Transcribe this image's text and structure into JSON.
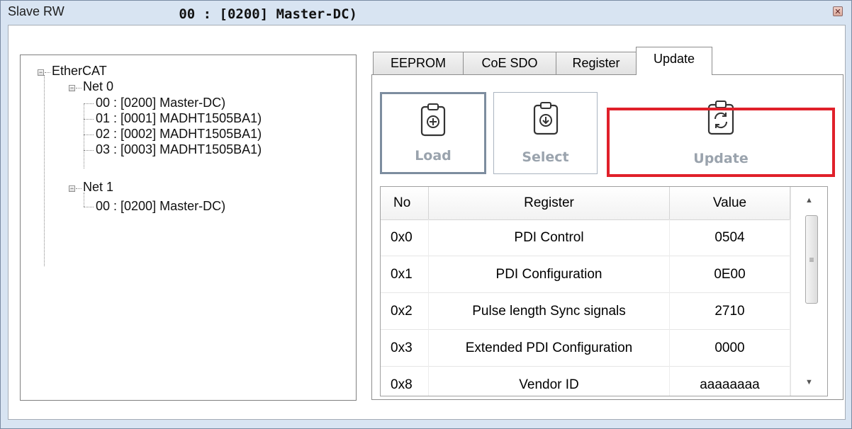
{
  "window": {
    "title": "Slave RW",
    "close_glyph": "✕"
  },
  "slave_header": "00 : [0200] Master-DC)",
  "tree": {
    "root": "EtherCAT",
    "net0": {
      "label": "Net 0",
      "children": [
        "00 : [0200] Master-DC)",
        "01 : [0001] MADHT1505BA1)",
        "02 : [0002] MADHT1505BA1)",
        "03 : [0003] MADHT1505BA1)"
      ]
    },
    "net1": {
      "label": "Net 1",
      "children": [
        "00 : [0200] Master-DC)"
      ]
    }
  },
  "tabs": [
    {
      "label": "EEPROM",
      "active": false
    },
    {
      "label": "CoE SDO",
      "active": false
    },
    {
      "label": "Register",
      "active": false
    },
    {
      "label": "Update",
      "active": true
    }
  ],
  "toolbar": {
    "load_label": "Load",
    "select_label": "Select",
    "update_label": "Update"
  },
  "grid": {
    "columns": [
      "No",
      "Register",
      "Value"
    ],
    "rows": [
      {
        "no": "0x0",
        "register": "PDI Control",
        "value": "0504"
      },
      {
        "no": "0x1",
        "register": "PDI Configuration",
        "value": "0E00"
      },
      {
        "no": "0x2",
        "register": "Pulse length Sync signals",
        "value": "2710"
      },
      {
        "no": "0x3",
        "register": "Extended PDI Configuration",
        "value": "0000"
      },
      {
        "no": "0x8",
        "register": "Vendor ID",
        "value": "aaaaaaaa"
      }
    ]
  },
  "colors": {
    "highlight": "#e0202a",
    "window_bg": "#d8e4f2",
    "button_text": "#9aa3ad"
  },
  "icons": {
    "load": "clipboard-plus-icon",
    "select": "clipboard-download-icon",
    "update": "clipboard-refresh-icon"
  }
}
